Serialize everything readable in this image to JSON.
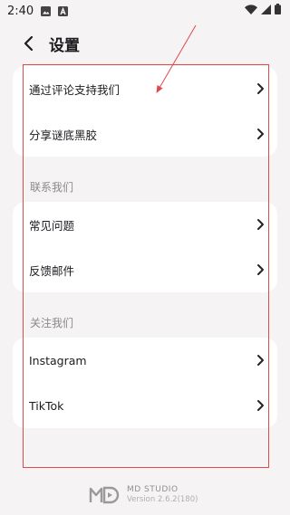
{
  "status_bar": {
    "time": "2:40",
    "icons": [
      "image-icon",
      "a-icon"
    ],
    "right_icons": [
      "wifi-icon",
      "signal-icon",
      "battery-icon"
    ]
  },
  "app_bar": {
    "title": "设置"
  },
  "sections": {
    "support": {
      "items": [
        {
          "label": "通过评论支持我们"
        },
        {
          "label": "分享谜底黑胶"
        }
      ]
    },
    "contact": {
      "header": "联系我们",
      "items": [
        {
          "label": "常见问题"
        },
        {
          "label": "反馈邮件"
        }
      ]
    },
    "follow": {
      "header": "关注我们",
      "items": [
        {
          "label": "Instagram"
        },
        {
          "label": "TikTok"
        }
      ]
    }
  },
  "footer": {
    "brand": "MD STUDIO",
    "version": "Version 2.6.2(180)"
  },
  "colors": {
    "background": "#f5f3f4",
    "card": "#ffffff",
    "annotation": "#e04a4a"
  }
}
